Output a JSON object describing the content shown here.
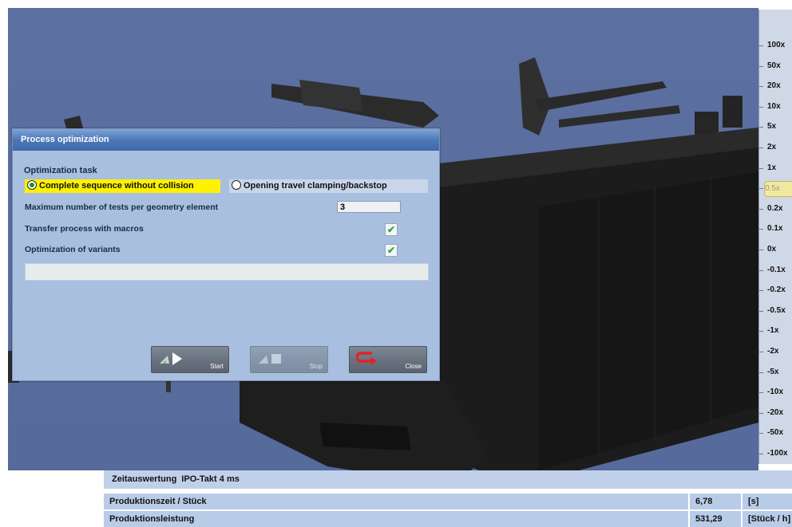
{
  "dialog": {
    "title": "Process optimization",
    "optimization_task_label": "Optimization task",
    "radio_complete": "Complete sequence without collision",
    "radio_opening": "Opening travel clamping/backstop",
    "max_tests_label": "Maximum number of tests per geometry element",
    "max_tests_value": "3",
    "transfer_label": "Transfer process with macros",
    "variants_label": "Optimization of variants",
    "start_label": "Start",
    "stop_label": "Stop",
    "close_label": "Close"
  },
  "speed_scale": {
    "items": [
      "100x",
      "50x",
      "20x",
      "10x",
      "5x",
      "2x",
      "1x",
      "0.5x",
      "0.2x",
      "0.1x",
      "0x",
      "-0.1x",
      "-0.2x",
      "-0.5x",
      "-1x",
      "-2x",
      "-5x",
      "-10x",
      "-20x",
      "-50x",
      "-100x"
    ],
    "selected": "0.5x"
  },
  "time_panel": {
    "header_title": "Zeitauswertung",
    "ipo_label": "IPO-Takt 4 ms",
    "rows": [
      {
        "label": "Produktionszeit / Stück",
        "value": "6,78",
        "unit": "[s]"
      },
      {
        "label": "Produktionsleistung",
        "value": "531,29",
        "unit": "[Stück / h]"
      }
    ]
  },
  "colors": {
    "viewport_bg": "#5b6fa0",
    "dialog_bg": "#a9bfdf",
    "title_bar": "#4c78b8",
    "highlight": "#fff200",
    "check_green": "#3aa23a"
  }
}
